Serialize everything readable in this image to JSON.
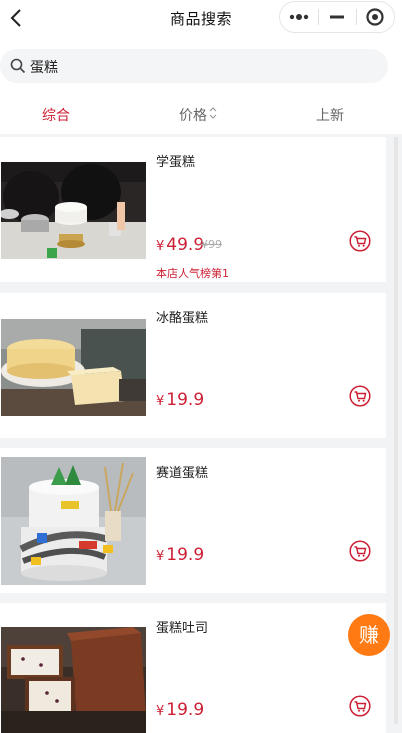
{
  "header": {
    "title": "商品搜索",
    "back_icon": "chevron-left-icon",
    "capsule_icons": [
      "more-dots-icon",
      "minimize-icon",
      "close-target-icon"
    ]
  },
  "search": {
    "value": "蛋糕",
    "icon": "search-icon"
  },
  "sort": {
    "items": [
      {
        "label": "综合",
        "active": true
      },
      {
        "label": "价格",
        "active": false,
        "icon": "sort-caret-icon"
      },
      {
        "label": "上新",
        "active": false
      }
    ]
  },
  "products": [
    {
      "name": "学蛋糕",
      "price": "49.9",
      "currency": "¥",
      "old_price": "¥99",
      "rank_text": "本店人气榜第1",
      "image": "cake-class-photo"
    },
    {
      "name": "冰酪蛋糕",
      "price": "19.9",
      "currency": "¥",
      "image": "cheese-cake-photo"
    },
    {
      "name": "赛道蛋糕",
      "price": "19.9",
      "currency": "¥",
      "image": "race-track-cake-photo"
    },
    {
      "name": "蛋糕吐司",
      "price": "19.9",
      "currency": "¥",
      "image": "cake-toast-photo"
    }
  ],
  "floating": {
    "label": "赚"
  },
  "colors": {
    "accent": "#cc1f33",
    "earn": "#ff7a12",
    "background": "#f2f3f5"
  }
}
